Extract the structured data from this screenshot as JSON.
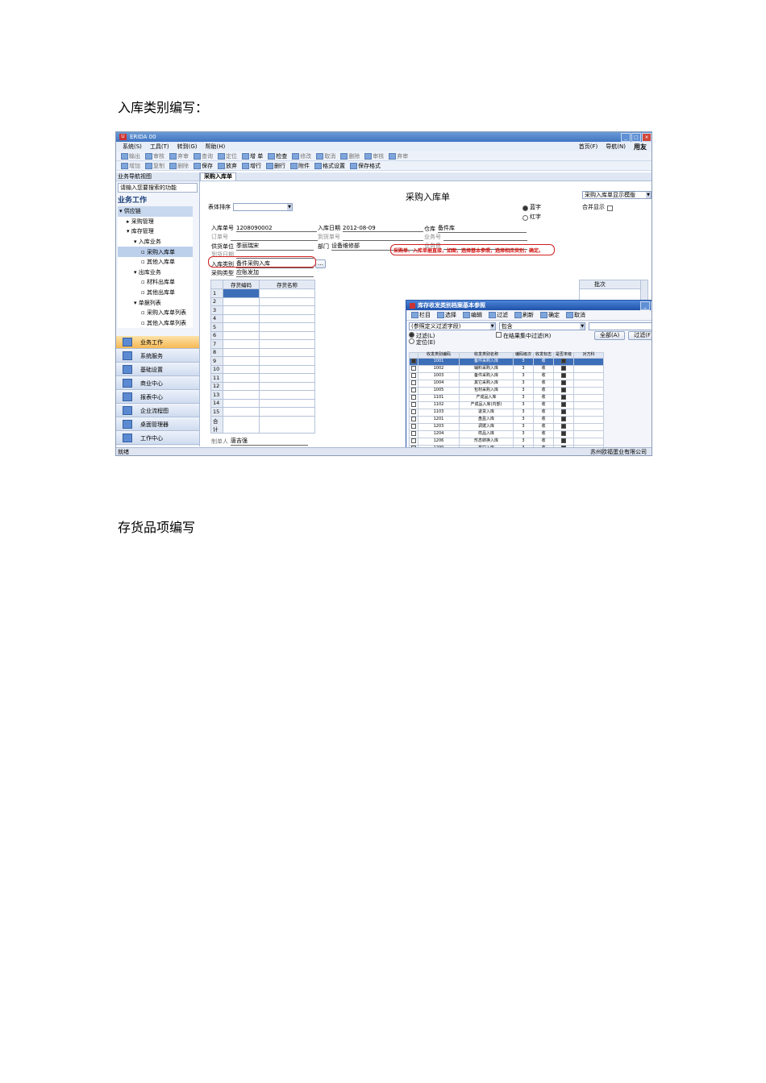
{
  "headings": {
    "first": "入库类别编写：",
    "second": "存货品项编写"
  },
  "app": {
    "title": "ERIDA  00",
    "menus": [
      "系统(S)",
      "工具(T)",
      "转到(G)",
      "帮助(H)"
    ],
    "menu_right": [
      "首页(F)",
      "导航(N)"
    ],
    "brand": "用友",
    "toolbar1": [
      "输出",
      "审核",
      "弃审",
      "查询",
      "定位",
      "增 单",
      "检查",
      "修改",
      "取消",
      "删除",
      "审核",
      "弃审"
    ],
    "toolbar2": [
      "增加",
      "复制",
      "删除",
      "保存",
      "放弃",
      "增行",
      "删行",
      "附件",
      "格式设置",
      "保存格式"
    ],
    "status_left": "就绪",
    "status_company": "苏州欧福蛋业有限公司"
  },
  "nav": {
    "panel_title": "业务导航视图",
    "search_placeholder": "请输入您要搜索的功能",
    "section_title": "业务工作",
    "tree": [
      {
        "label": "供应链",
        "indent": 0,
        "kind": "cat"
      },
      {
        "label": "采购管理",
        "indent": 1,
        "kind": "item"
      },
      {
        "label": "库存管理",
        "indent": 1,
        "kind": "item"
      },
      {
        "label": "入库业务",
        "indent": 2,
        "kind": "item"
      },
      {
        "label": "采购入库单",
        "indent": 3,
        "kind": "sel"
      },
      {
        "label": "其他入库单",
        "indent": 3,
        "kind": "item"
      },
      {
        "label": "出库业务",
        "indent": 2,
        "kind": "item"
      },
      {
        "label": "材料出库单",
        "indent": 3,
        "kind": "item"
      },
      {
        "label": "其他出库单",
        "indent": 3,
        "kind": "item"
      },
      {
        "label": "单据列表",
        "indent": 2,
        "kind": "item"
      },
      {
        "label": "采购入库单列表",
        "indent": 3,
        "kind": "item"
      },
      {
        "label": "其他入库单列表",
        "indent": 3,
        "kind": "item"
      }
    ],
    "buttons": [
      "业务工作",
      "系统服务",
      "基础设置",
      "商业中心",
      "报表中心",
      "企业流程图",
      "桌面管理器",
      "工作中心"
    ]
  },
  "form": {
    "tab": "采购入库单",
    "title": "采购入库单",
    "sort_label": "表体排序",
    "template": "采购入库单显示模版",
    "radio_blue": "蓝字",
    "radio_red": "红字",
    "merge_label": "合并显示",
    "fields": {
      "order_no_label": "入库单号",
      "order_no": "1208090002",
      "date_label": "入库日期",
      "date": "2012-08-09",
      "warehouse_label": "仓库",
      "warehouse": "备件库",
      "po_label": "订单号",
      "arrival_label": "到货单号",
      "biz_no_label": "业务号",
      "supplier_label": "供货单位",
      "supplier": "季丽瑞宋",
      "dept_label": "部门",
      "dept": "设备维修部",
      "clerk_label": "业务员",
      "arrival_date_label": "到货日期",
      "type_label": "入库类别",
      "type": "备件采购入库",
      "audit_label": "审核日期",
      "acct_label": "采购类型",
      "acct": "应账发加"
    },
    "note": "采购单、入库单据直接，如图，选择基本参照，选择相应类别，确定。",
    "grid_headers": [
      "存货编码",
      "存货名称"
    ],
    "rows": [
      "1",
      "2",
      "3",
      "4",
      "5",
      "6",
      "7",
      "8",
      "9",
      "10",
      "11",
      "12",
      "13",
      "14",
      "15"
    ],
    "total_label": "合计",
    "right_header": "批次",
    "maker_label": "制单人",
    "maker": "唐吉强"
  },
  "dialog": {
    "title": "库存收发类别档案基本参照",
    "tools": [
      "栏目",
      "选择",
      "编辑",
      "过滤",
      "刷新",
      "确定",
      "取消"
    ],
    "filter_field": "(参照定义过滤字段)",
    "filter_op": "包含",
    "radio_filter": "过滤(L)",
    "radio_locate": "定位(E)",
    "check_label": "在结果集中过滤(R)",
    "btn_all": "全部(A)",
    "btn_filter": "过滤(F)",
    "headers": [
      "",
      "收发类别编码",
      "收发类别名称",
      "编码级次",
      "收发标志",
      "是否末级",
      "对方科"
    ],
    "rows": [
      {
        "code": "1001",
        "name": "备件采购入库",
        "level": "3",
        "flag": "收",
        "sel": true
      },
      {
        "code": "1002",
        "name": "辅料采购入库",
        "level": "3",
        "flag": "收",
        "sel": false
      },
      {
        "code": "1003",
        "name": "备件采购入库",
        "level": "3",
        "flag": "收",
        "sel": false
      },
      {
        "code": "1004",
        "name": "其它采购入库",
        "level": "3",
        "flag": "收",
        "sel": false
      },
      {
        "code": "1005",
        "name": "包材采购入库",
        "level": "3",
        "flag": "收",
        "sel": false
      },
      {
        "code": "1101",
        "name": "产成品入库",
        "level": "3",
        "flag": "收",
        "sel": false
      },
      {
        "code": "1102",
        "name": "产成品入库(内部)",
        "level": "3",
        "flag": "收",
        "sel": false
      },
      {
        "code": "1103",
        "name": "退货入库",
        "level": "3",
        "flag": "收",
        "sel": false
      },
      {
        "code": "1201",
        "name": "盘盈入库",
        "level": "3",
        "flag": "收",
        "sel": false
      },
      {
        "code": "1203",
        "name": "调拨入库",
        "level": "3",
        "flag": "收",
        "sel": false
      },
      {
        "code": "1204",
        "name": "样品入库",
        "level": "3",
        "flag": "收",
        "sel": false
      },
      {
        "code": "1206",
        "name": "形态转换入库",
        "level": "3",
        "flag": "收",
        "sel": false
      },
      {
        "code": "1299",
        "name": "其它入库",
        "level": "3",
        "flag": "收",
        "sel": false
      }
    ]
  },
  "colors": {
    "titlebar": "#3f74c2",
    "highlight": "#3d6fb8",
    "annotation": "#d02020"
  }
}
